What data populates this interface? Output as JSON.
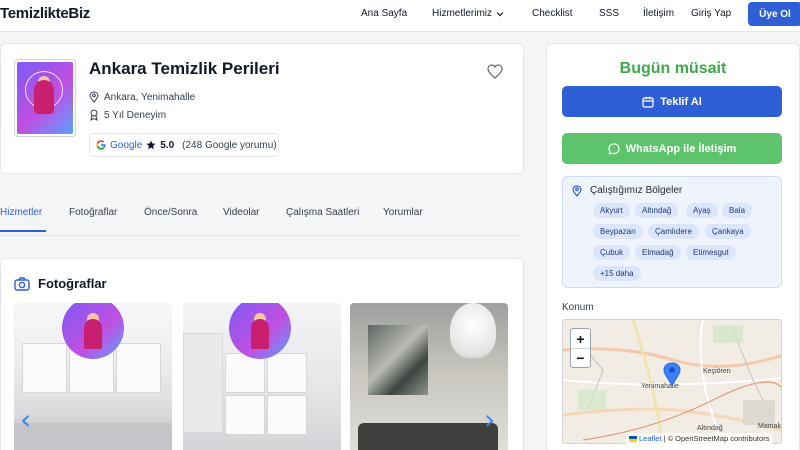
{
  "header": {
    "logo": "TemizlikteBiz",
    "nav": [
      "Ana Sayfa",
      "Hizmetlerimiz",
      "Checklist",
      "SSS",
      "İletişim",
      "Giriş Yap"
    ],
    "member_button": "Üye Ol"
  },
  "profile": {
    "name": "Ankara Temizlik Perileri",
    "location": "Ankara, Yenimahalle",
    "experience": "5 Yıl Deneyim",
    "google_label": "Google",
    "rating": "5.0",
    "reviews": "(248 Google yorumu)"
  },
  "tabs": [
    "Hizmetler",
    "Fotoğraflar",
    "Önce/Sonra",
    "Videolar",
    "Çalışma Saatleri",
    "Yorumlar"
  ],
  "photos": {
    "title": "Fotoğraflar"
  },
  "sidebar": {
    "availability": "Bugün müsait",
    "offer_button": "Teklif Al",
    "whatsapp_button": "WhatsApp ile İletişim",
    "regions_title": "Çalıştığımız Bölgeler",
    "regions": [
      "Akyurt",
      "Altındağ",
      "Ayaş",
      "Bala",
      "Beypazarı",
      "Çamlıdere",
      "Çankaya",
      "Çubuk",
      "Elmadağ",
      "Etimesgut",
      "+15 daha"
    ],
    "location_label": "Konum"
  },
  "map": {
    "zoom_in": "+",
    "zoom_out": "−",
    "labels": [
      "Keçiören",
      "Yenimahalle",
      "Altındağ",
      "Mamak"
    ],
    "attribution_leaflet": "Leaflet",
    "attribution_osm": "| © OpenStreetMap contributors"
  },
  "colors": {
    "primary": "#2f5fd6",
    "success": "#3ea84a",
    "whatsapp": "#5ec46c"
  }
}
